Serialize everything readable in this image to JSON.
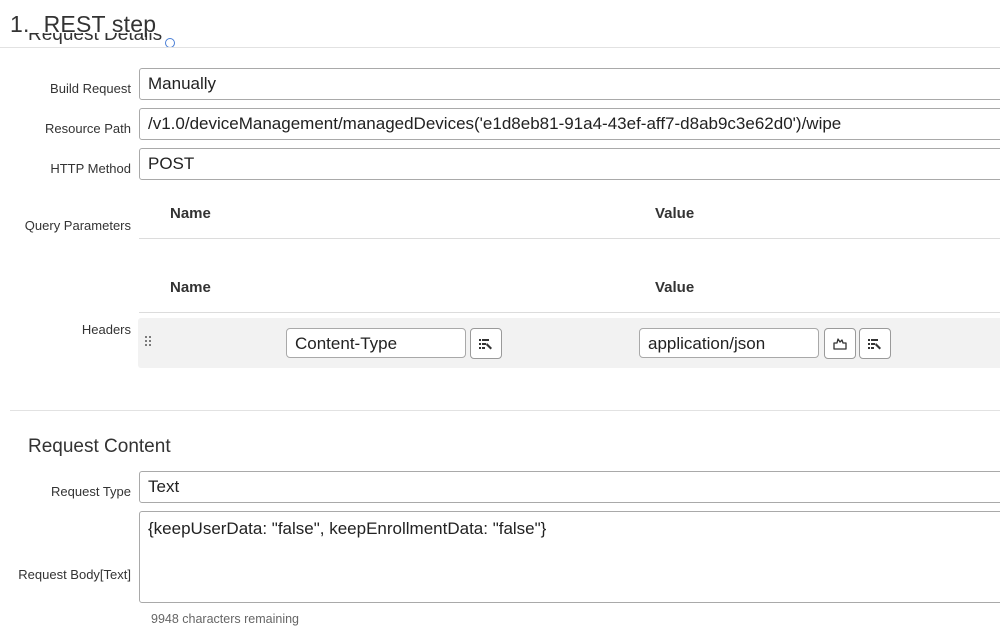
{
  "page": {
    "step_number": "1.",
    "title": "REST step"
  },
  "request_details": {
    "section_title": "Request Details",
    "build_request": {
      "label": "Build Request",
      "value": "Manually"
    },
    "resource_path": {
      "label": "Resource Path",
      "value": "/v1.0/deviceManagement/managedDevices('e1d8eb81-91a4-43ef-aff7-d8ab9c3e62d0')/wipe"
    },
    "http_method": {
      "label": "HTTP Method",
      "value": "POST"
    },
    "query_parameters": {
      "label": "Query Parameters",
      "columns": [
        "Name",
        "Value"
      ]
    },
    "headers": {
      "label": "Headers",
      "columns": [
        "Name",
        "Value"
      ],
      "rows": [
        {
          "name": "Content-Type",
          "value": "application/json"
        }
      ]
    }
  },
  "request_content": {
    "section_title": "Request Content",
    "request_type": {
      "label": "Request Type",
      "value": "Text"
    },
    "request_body": {
      "label": "Request Body[Text]",
      "value": "{keepUserData: \"false\", keepEnrollmentData: \"false\"}",
      "chars_remaining": "9948 characters remaining"
    }
  },
  "icons": {
    "variable_picker": "variable-picker-icon",
    "secret": "secret-icon",
    "drag": "drag-handle-icon",
    "info": "info-icon"
  }
}
